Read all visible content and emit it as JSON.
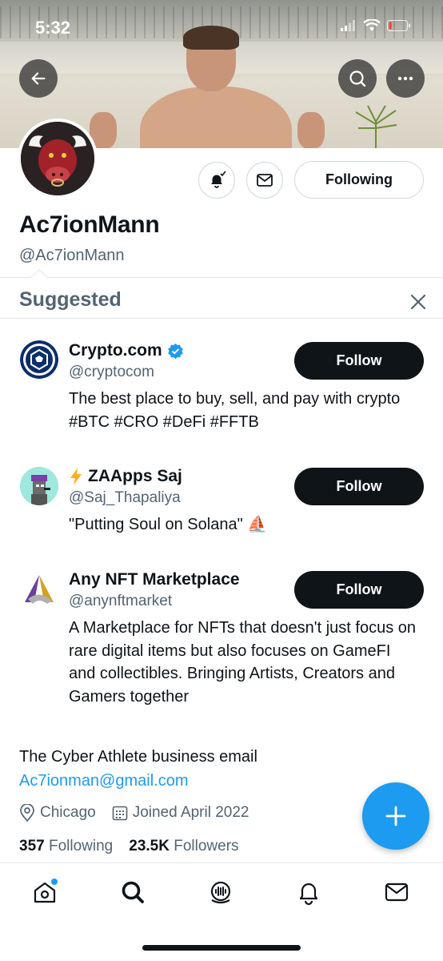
{
  "status_bar": {
    "time": "5:32"
  },
  "profile": {
    "display_name": "Ac7ionMann",
    "handle": "@Ac7ionMann",
    "following_button": "Following",
    "bio": "The Cyber Athlete business email",
    "email": "Ac7ionman@gmail.com",
    "location": "Chicago",
    "joined": "Joined April 2022",
    "following_count": "357",
    "following_label": "Following",
    "followers_count": "23.5K",
    "followers_label": "Followers"
  },
  "suggested": {
    "title": "Suggested",
    "items": [
      {
        "name": "Crypto.com",
        "verified": true,
        "handle": "@cryptocom",
        "bio": "The best place to buy, sell, and pay with crypto #BTC #CRO #DeFi #FFTB",
        "button": "Follow"
      },
      {
        "name_prefix_icon": "lightning-icon",
        "name": "ZAApps Saj",
        "handle": "@Saj_Thapaliya",
        "bio": "\"Putting Soul on Solana\" ⛵",
        "button": "Follow"
      },
      {
        "name": "Any NFT Marketplace",
        "handle": "@anynftmarket",
        "bio": "A Marketplace for NFTs that doesn't just focus on rare digital items but also focuses on GameFI and collectibles. Bringing Artists, Creators and Gamers together",
        "button": "Follow"
      }
    ]
  },
  "colors": {
    "accent": "#1d9bf0",
    "text_primary": "#0f1419",
    "text_secondary": "#536471",
    "button_dark": "#0f1419",
    "border": "#cfd9de"
  },
  "icons": {
    "back": "back-arrow-icon",
    "search": "search-icon",
    "more": "more-horizontal-icon",
    "notifications": "bell-subscribed-icon",
    "message": "envelope-icon",
    "close": "close-icon",
    "location": "location-pin-icon",
    "calendar": "calendar-icon",
    "compose": "plus-icon"
  },
  "tabbar": {
    "items": [
      "home-icon",
      "search-icon",
      "spaces-icon",
      "notifications-icon",
      "messages-icon"
    ],
    "home_has_dot": true
  }
}
